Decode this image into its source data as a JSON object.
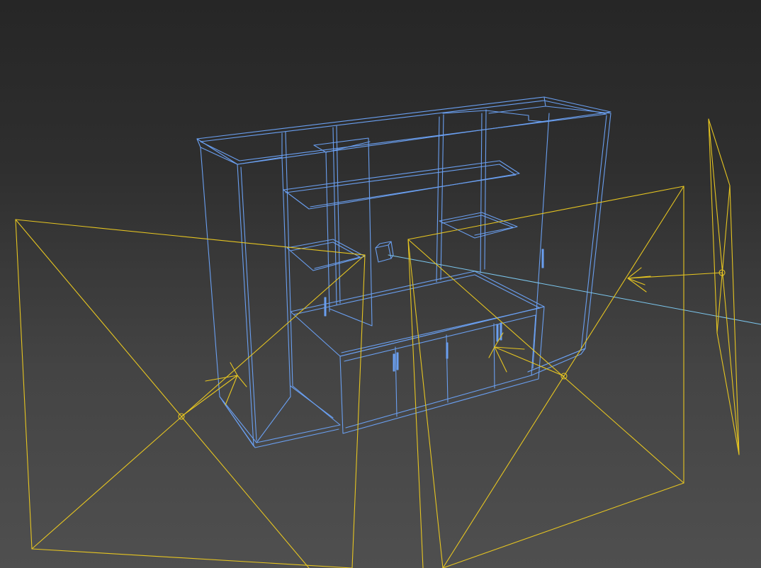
{
  "viewport": {
    "type": "3d-perspective-wireframe",
    "colors": {
      "background_top": "#262626",
      "background_bottom": "#4f4f4f",
      "cabinet_wire": "#6a9ff0",
      "light_wire": "#e6c521",
      "target_line": "#7cc7ee"
    }
  },
  "objects": [
    {
      "name": "tv-wall-cabinet",
      "kind": "mesh-wireframe",
      "selected": true
    },
    {
      "name": "spot-light-left",
      "kind": "target-light"
    },
    {
      "name": "spot-light-center",
      "kind": "target-light"
    },
    {
      "name": "spot-light-right",
      "kind": "target-light"
    },
    {
      "name": "light-target-box",
      "kind": "helper"
    }
  ]
}
